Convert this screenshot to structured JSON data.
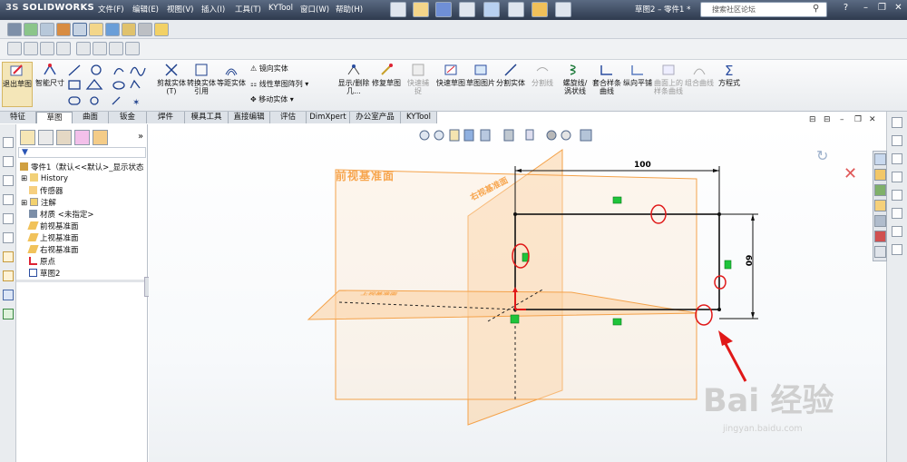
{
  "app": {
    "logo_prefix": "3S",
    "logo_text": "SOLIDWORKS",
    "doc_title": "草图2 – 零件1 *"
  },
  "menu": [
    "文件(F)",
    "编辑(E)",
    "视图(V)",
    "插入(I)",
    "工具(T)",
    "KYTool",
    "窗口(W)",
    "帮助(H)"
  ],
  "search": {
    "placeholder": "搜索社区论坛"
  },
  "ribbon": {
    "exit_sketch": "退出草图",
    "smart_dim": "智能尺寸",
    "trim": "剪裁实体(T)",
    "convert": "转换实体引用",
    "offset": "等距实体",
    "mirror": "镜向实体",
    "linear_pattern": "线性草图阵列",
    "move": "移动实体",
    "show_delete": "显示/删除几...",
    "repair": "修复草图",
    "quick_snap": "快速捕捉",
    "quick_sketch": "快速草图",
    "sketch_picture": "草图图片",
    "split_entity": "分割实体",
    "split_line": "分割线",
    "helix": "螺旋线/涡状线",
    "composite": "套合样条曲线",
    "lateral": "纵向平铺",
    "curve_on_face": "曲面上的样条曲线",
    "combine": "组合曲线",
    "equation": "方程式"
  },
  "tabs": [
    "特征",
    "草图",
    "曲面",
    "钣金",
    "焊件",
    "模具工具",
    "直接编辑",
    "评估",
    "DimXpert",
    "办公室产品",
    "KYTool"
  ],
  "tabs_active_index": 1,
  "tree": {
    "root": "零件1（默认<<默认>_显示状态",
    "items": [
      "History",
      "传感器",
      "注解",
      "材质 <未指定>",
      "前视基准面",
      "上视基准面",
      "右视基准面",
      "原点",
      "草图2"
    ]
  },
  "viewport": {
    "dim_width": "100",
    "dim_height": "60",
    "plane_front": "前视基准面",
    "plane_right": "右视基准面",
    "plane_top": "上视基准面",
    "watermark": "Bai 经验",
    "watermark_url": "jingyan.baidu.com"
  },
  "colors": {
    "plane": "#f7a54d",
    "annotation": "#e01818",
    "relation": "#1fc43b",
    "titlebar": "#3a4760"
  }
}
